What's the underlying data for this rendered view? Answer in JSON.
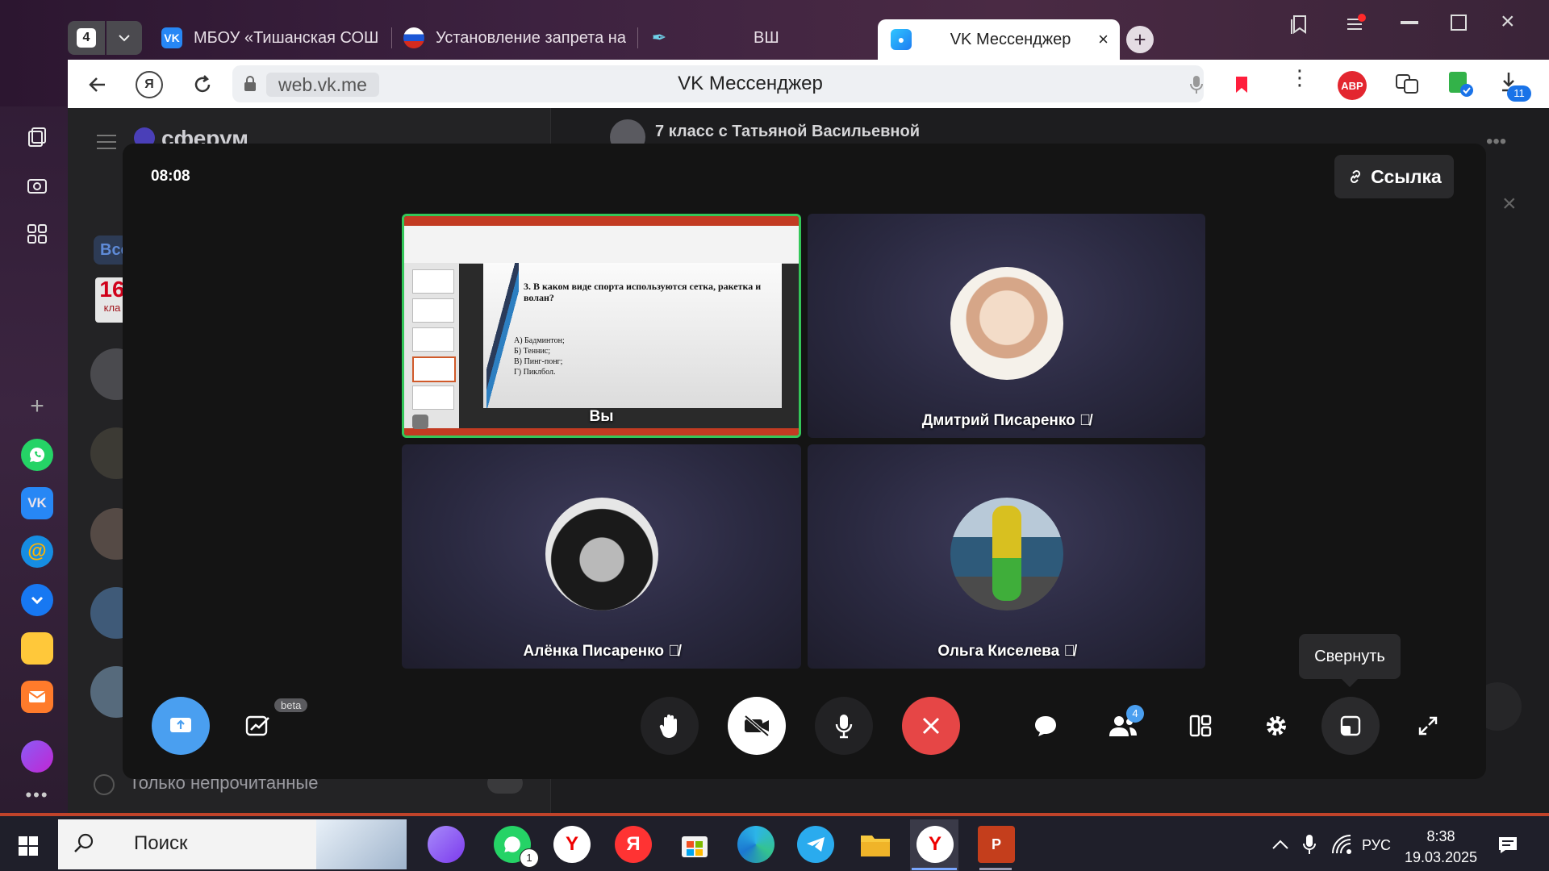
{
  "browser": {
    "workspace_count": "4",
    "tabs": [
      {
        "label": "МБОУ «Тишанская СОШ»",
        "icon": "vk-icon"
      },
      {
        "label": "Установление запрета на",
        "icon": "russia-flag-icon"
      },
      {
        "label": "ВШ",
        "icon": "feather-icon"
      },
      {
        "label": "VK Мессенджер",
        "icon": "vk-messenger-icon"
      }
    ],
    "url": "web.vk.me",
    "page_title": "VK Мессенджер",
    "abp_label": "ABP",
    "downloads_badge": "11",
    "left_counter": "4"
  },
  "backdrop": {
    "brand": "сферум",
    "chat_title": "7 класс с Татьяной Васильевной",
    "filter_tab": "Все",
    "unread_toggle_label": "Только непрочитанные",
    "calendar_day": "16",
    "calendar_month": "кла"
  },
  "call": {
    "timer": "08:08",
    "link_button": "Ссылка",
    "participants": [
      {
        "name": "Вы",
        "muted": false,
        "kind": "screen-share"
      },
      {
        "name": "Дмитрий Писаренко",
        "muted": true
      },
      {
        "name": "Алёнка Писаренко",
        "muted": true
      },
      {
        "name": "Ольга Киселева",
        "muted": true
      }
    ],
    "slide": {
      "question": "3. В каком виде спорта используются сетка, ракетка и волан?",
      "answers": [
        "А) Бадминтон;",
        "Б) Теннис;",
        "В) Пинг-понг;",
        "Г) Пиклбол."
      ]
    },
    "beta_badge": "beta",
    "participants_badge": "4",
    "tooltip": "Свернуть",
    "accent_color": "#4a9ff0",
    "end_call_color": "#e64646"
  },
  "taskbar": {
    "search_label": "Поиск",
    "whatsapp_badge": "1",
    "language": "РУС",
    "time": "8:38",
    "date": "19.03.2025"
  }
}
